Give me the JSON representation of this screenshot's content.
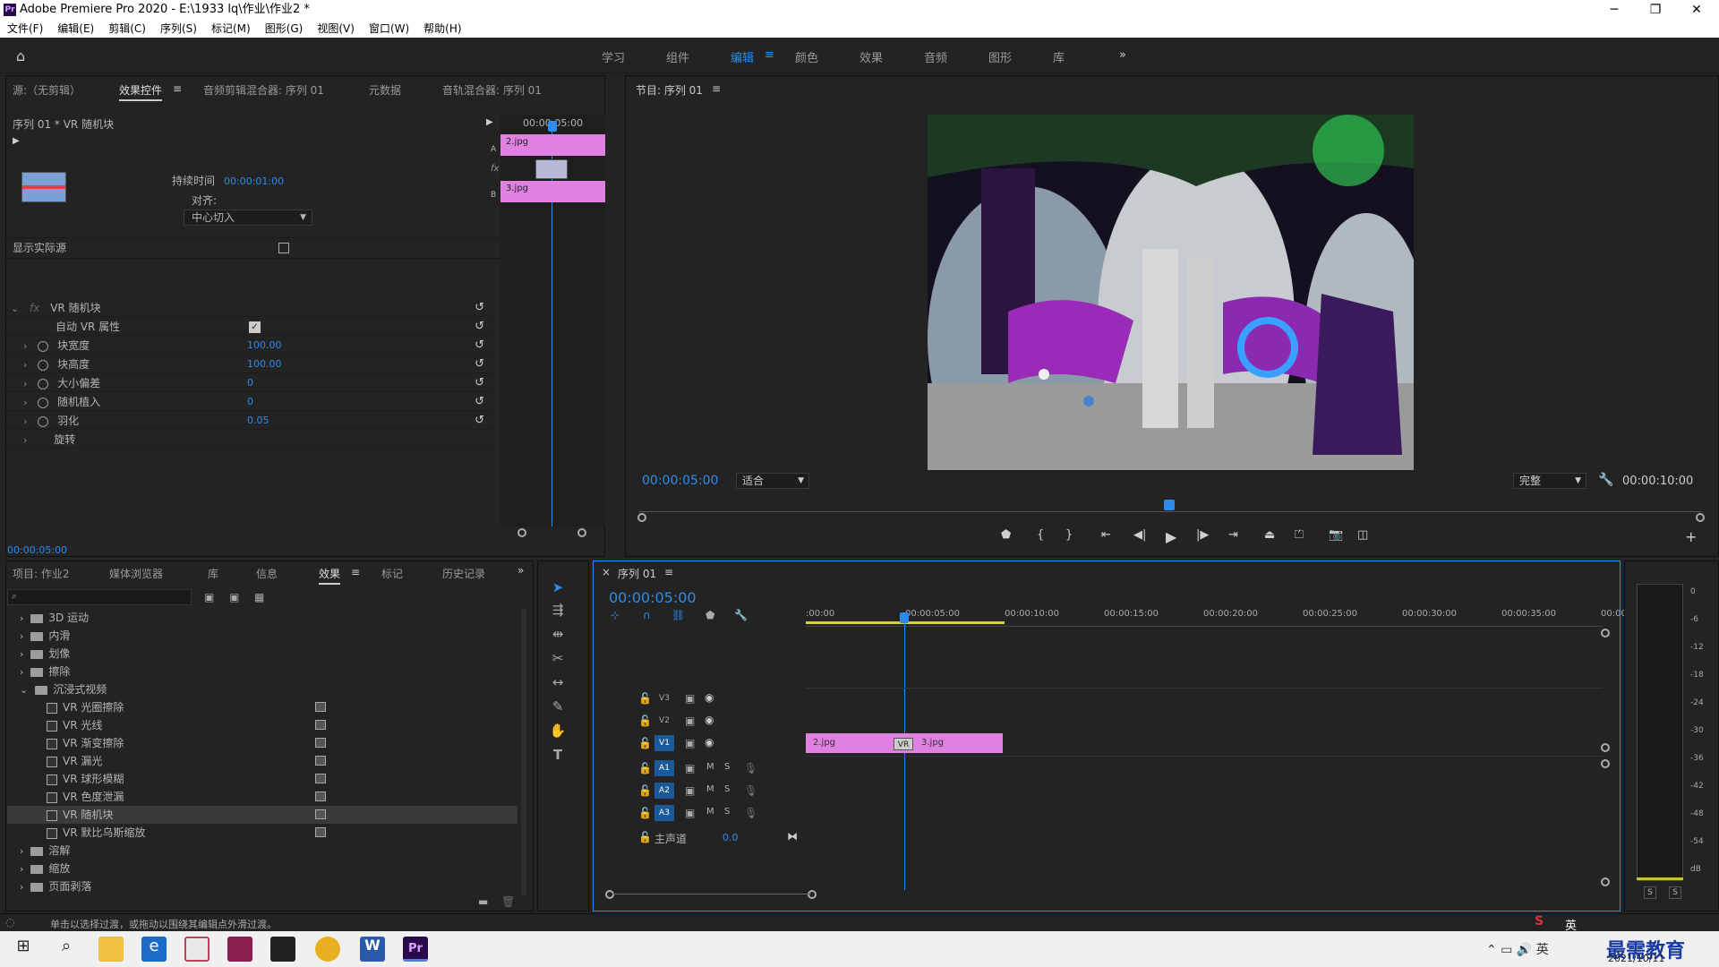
{
  "window": {
    "title": "Adobe Premiere Pro 2020 - E:\\1933 lq\\作业\\作业2 *"
  },
  "menu": [
    "文件(F)",
    "编辑(E)",
    "剪辑(C)",
    "序列(S)",
    "标记(M)",
    "图形(G)",
    "视图(V)",
    "窗口(W)",
    "帮助(H)"
  ],
  "workspaces": [
    "学习",
    "组件",
    "编辑",
    "颜色",
    "效果",
    "音频",
    "图形",
    "库"
  ],
  "source_panel": {
    "tabs": [
      "源:（无剪辑）",
      "效果控件",
      "音频剪辑混合器: 序列 01",
      "元数据",
      "音轨混合器: 序列 01"
    ],
    "clip_title": "序列 01 * VR 随机块",
    "mini_time": "00:00:05:00",
    "clip_a": "2.jpg",
    "clip_b": "3.jpg",
    "duration_label": "持续时间",
    "duration_value": "00:00:01:00",
    "align_label": "对齐:",
    "align_value": "中心切入",
    "show_actual": "显示实际源",
    "effect_name": "VR 随机块",
    "props": [
      {
        "name": "自动 VR 属性",
        "value": ""
      },
      {
        "name": "块宽度",
        "value": "100.00"
      },
      {
        "name": "块高度",
        "value": "100.00"
      },
      {
        "name": "大小偏差",
        "value": "0"
      },
      {
        "name": "随机植入",
        "value": "0"
      },
      {
        "name": "羽化",
        "value": "0.05"
      },
      {
        "name": "旋转",
        "value": ""
      }
    ],
    "timecode": "00:00:05:00"
  },
  "program_panel": {
    "title": "节目: 序列 01",
    "timecode": "00:00:05:00",
    "fit": "适合",
    "quality": "完整",
    "duration": "00:00:10:00"
  },
  "project_panel": {
    "tabs": [
      "项目: 作业2",
      "媒体浏览器",
      "库",
      "信息",
      "效果",
      "标记",
      "历史记录"
    ],
    "tree": [
      {
        "label": "3D 运动",
        "level": 0,
        "type": "folder"
      },
      {
        "label": "内滑",
        "level": 0,
        "type": "folder"
      },
      {
        "label": "划像",
        "level": 0,
        "type": "folder"
      },
      {
        "label": "擦除",
        "level": 0,
        "type": "folder"
      },
      {
        "label": "沉浸式视频",
        "level": 0,
        "type": "folder-open"
      },
      {
        "label": "VR 光圈擦除",
        "level": 1,
        "type": "fx"
      },
      {
        "label": "VR 光线",
        "level": 1,
        "type": "fx"
      },
      {
        "label": "VR 渐变擦除",
        "level": 1,
        "type": "fx"
      },
      {
        "label": "VR 漏光",
        "level": 1,
        "type": "fx"
      },
      {
        "label": "VR 球形模糊",
        "level": 1,
        "type": "fx"
      },
      {
        "label": "VR 色度泄漏",
        "level": 1,
        "type": "fx"
      },
      {
        "label": "VR 随机块",
        "level": 1,
        "type": "fx",
        "selected": true
      },
      {
        "label": "VR 默比乌斯缩放",
        "level": 1,
        "type": "fx"
      },
      {
        "label": "溶解",
        "level": 0,
        "type": "folder"
      },
      {
        "label": "缩放",
        "level": 0,
        "type": "folder"
      },
      {
        "label": "页面剥落",
        "level": 0,
        "type": "folder"
      }
    ]
  },
  "timeline": {
    "title": "序列 01",
    "timecode": "00:00:05:00",
    "ticks": [
      ":00:00",
      "00:00:05:00",
      "00:00:10:00",
      "00:00:15:00",
      "00:00:20:00",
      "00:00:25:00",
      "00:00:30:00",
      "00:00:35:00",
      "00:00"
    ],
    "video_tracks": [
      "V3",
      "V2",
      "V1"
    ],
    "audio_tracks": [
      "A1",
      "A2",
      "A3"
    ],
    "master_label": "主声道",
    "master_value": "0.0",
    "clips": [
      {
        "label": "2.jpg"
      },
      {
        "label": "3.jpg"
      }
    ],
    "transition": "VR",
    "m": "M",
    "s": "S"
  },
  "meter": {
    "labels": [
      "0",
      "-6",
      "-12",
      "-18",
      "-24",
      "-30",
      "-36",
      "-42",
      "-48",
      "-54",
      "dB"
    ],
    "s1": "S",
    "s2": "S"
  },
  "status": "单击以选择过渡，或拖动以围绕其编辑点外滑过渡。",
  "taskbar": {
    "date": "2021/10/11",
    "ime": "英",
    "watermark": "最需教育"
  }
}
